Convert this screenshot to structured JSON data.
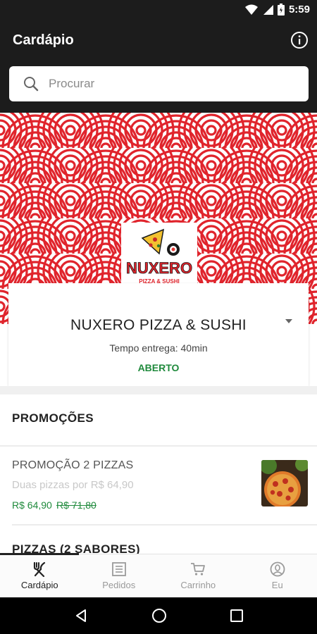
{
  "status_bar": {
    "time": "5:59"
  },
  "app_bar": {
    "title": "Cardápio"
  },
  "search": {
    "placeholder": "Procurar"
  },
  "store": {
    "logo_text": "NUXERO",
    "logo_subtext": "PIZZA & SUSHI",
    "name": "NUXERO PIZZA & SUSHI",
    "delivery_time": "Tempo entrega: 40min",
    "status": "ABERTO"
  },
  "sections": [
    {
      "title": "PROMOÇÕES",
      "items": [
        {
          "name": "PROMOÇÃO 2 PIZZAS",
          "description": "Duas pizzas por R$ 64,90",
          "price": "R$ 64,90",
          "old_price": "R$ 71,80"
        }
      ]
    },
    {
      "title": "PIZZAS (2 SABORES)"
    }
  ],
  "bottom_nav": [
    {
      "label": "Cardápio",
      "icon": "fork-knife-icon",
      "active": true
    },
    {
      "label": "Pedidos",
      "icon": "list-icon",
      "active": false
    },
    {
      "label": "Carrinho",
      "icon": "cart-icon",
      "active": false
    },
    {
      "label": "Eu",
      "icon": "user-icon",
      "active": false
    }
  ],
  "colors": {
    "app_bar": "#1c1c1c",
    "banner_red": "#e0242c",
    "open_green": "#1f8a3c",
    "price_green": "#1f8a3c"
  }
}
